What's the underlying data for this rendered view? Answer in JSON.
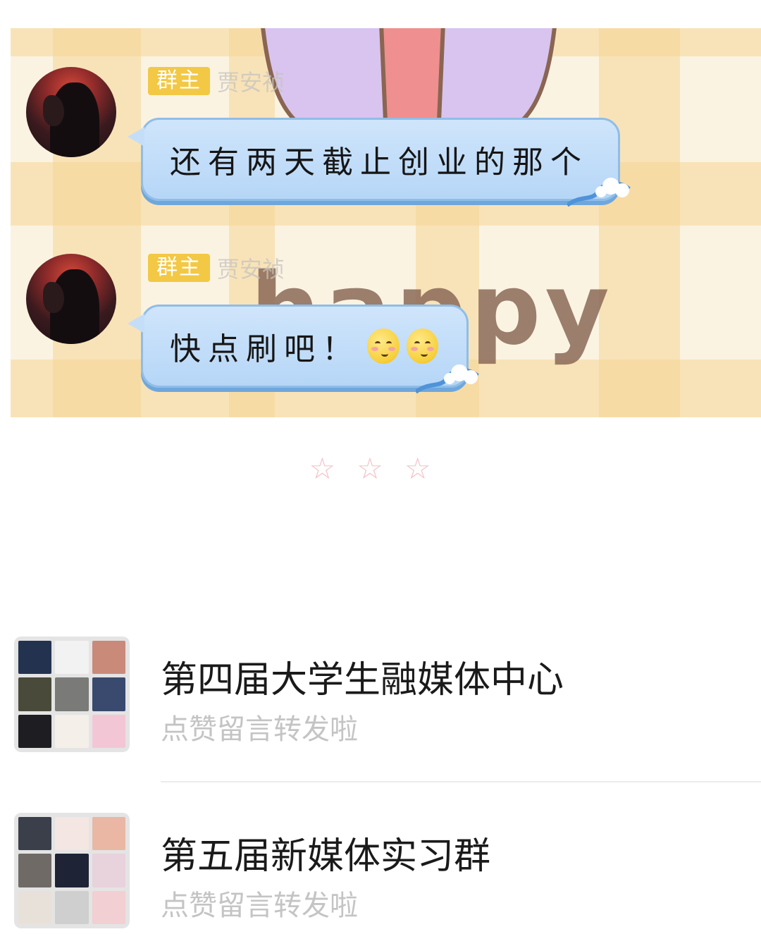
{
  "chat": {
    "messages": [
      {
        "role_badge": "群主",
        "sender_name": "贾安祯",
        "text": "还有两天截止创业的那个"
      },
      {
        "role_badge": "群主",
        "sender_name": "贾安祯",
        "text": "快点刷吧！"
      }
    ],
    "background_text": "happy"
  },
  "divider_stars": "☆☆☆",
  "groups": [
    {
      "name": "第四届大学生融媒体中心",
      "preview": "点赞留言转发啦",
      "avatar_colors": [
        "#23324f",
        "#f2f2f2",
        "#c98a7a",
        "#4a4a3a",
        "#7a7a78",
        "#3a4a6e",
        "#1e1e22",
        "#f4efe9",
        "#f3c6d6"
      ]
    },
    {
      "name": "第五届新媒体实习群",
      "preview": "点赞留言转发啦",
      "avatar_colors": [
        "#3a3f4a",
        "#f4e6e2",
        "#e9b7a4",
        "#6f6a66",
        "#1f2336",
        "#e8d2dc",
        "#e7e1d9",
        "#cfcfcf",
        "#f1cfd2"
      ]
    }
  ],
  "colors": {
    "badge": "#f2c845",
    "bubble": "#b6d6f7",
    "stars": "#f3c2c8",
    "preview_text": "#c4c4c4"
  }
}
